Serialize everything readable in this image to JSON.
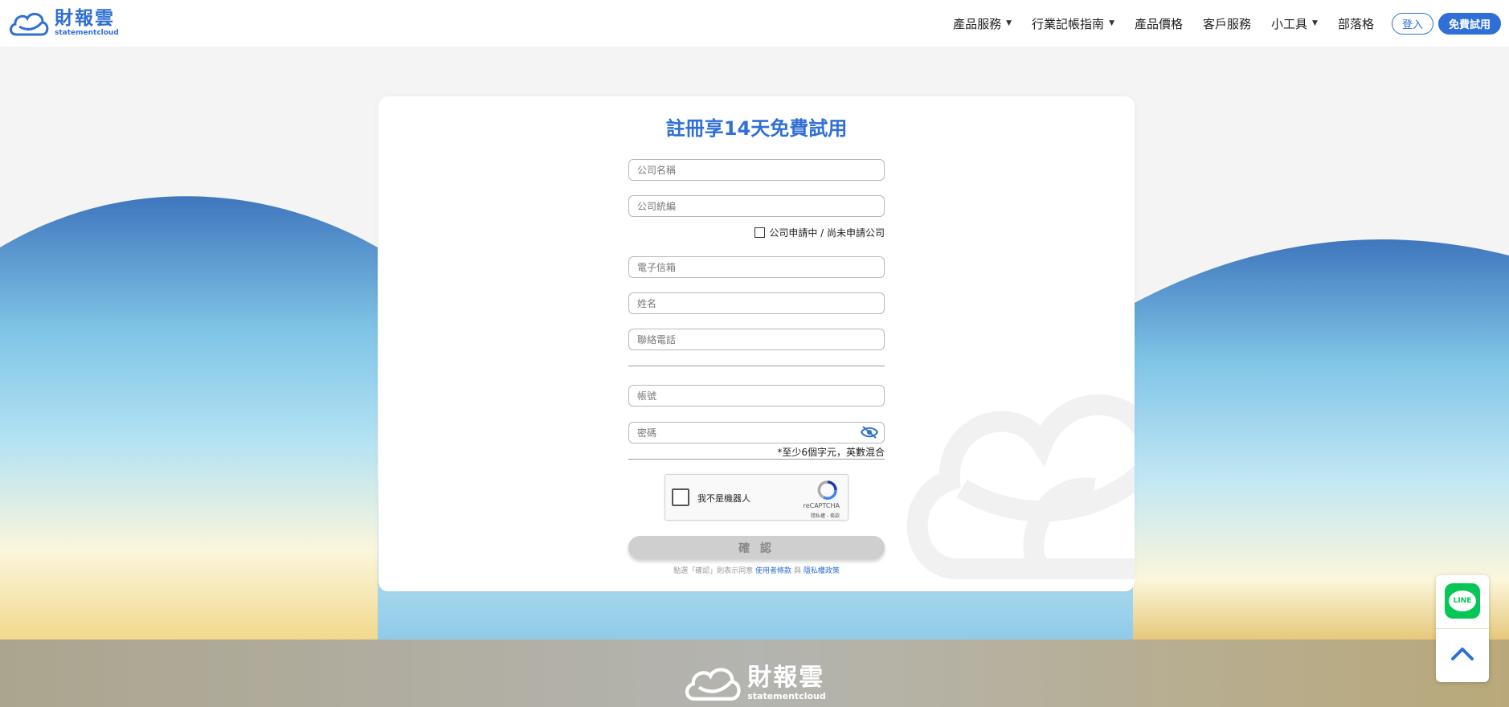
{
  "brand": {
    "name_cn": "財報雲",
    "name_en": "statementcloud",
    "color": "#2f6fd6"
  },
  "nav": {
    "items": [
      {
        "label": "產品服務",
        "dropdown": true
      },
      {
        "label": "行業記帳指南",
        "dropdown": true
      },
      {
        "label": "產品價格",
        "dropdown": false
      },
      {
        "label": "客戶服務",
        "dropdown": false
      },
      {
        "label": "小工具",
        "dropdown": true
      },
      {
        "label": "部落格",
        "dropdown": false
      }
    ],
    "login_label": "登入",
    "trial_label": "免費試用"
  },
  "form": {
    "title": "註冊享14天免費試用",
    "company_name_placeholder": "公司名稱",
    "tax_id_placeholder": "公司統編",
    "applying_label": "公司申請中 / 尚未申請公司",
    "email_placeholder": "電子信箱",
    "name_placeholder": "姓名",
    "phone_placeholder": "聯絡電話",
    "account_placeholder": "帳號",
    "password_placeholder": "密碼",
    "password_hint": "*至少6個字元，英數混合",
    "submit_label": "確 認",
    "terms_prefix": "點選「確認」則表示同意",
    "terms_link": "使用者條款",
    "terms_and": "與",
    "privacy_link": "隱私權政策"
  },
  "captcha": {
    "label": "我不是機器人",
    "brand": "reCAPTCHA",
    "links": "隱私權 - 條款"
  },
  "widgets": {
    "line_label": "LINE"
  },
  "footer": {
    "name_cn": "財報雲",
    "name_en": "statementcloud"
  }
}
